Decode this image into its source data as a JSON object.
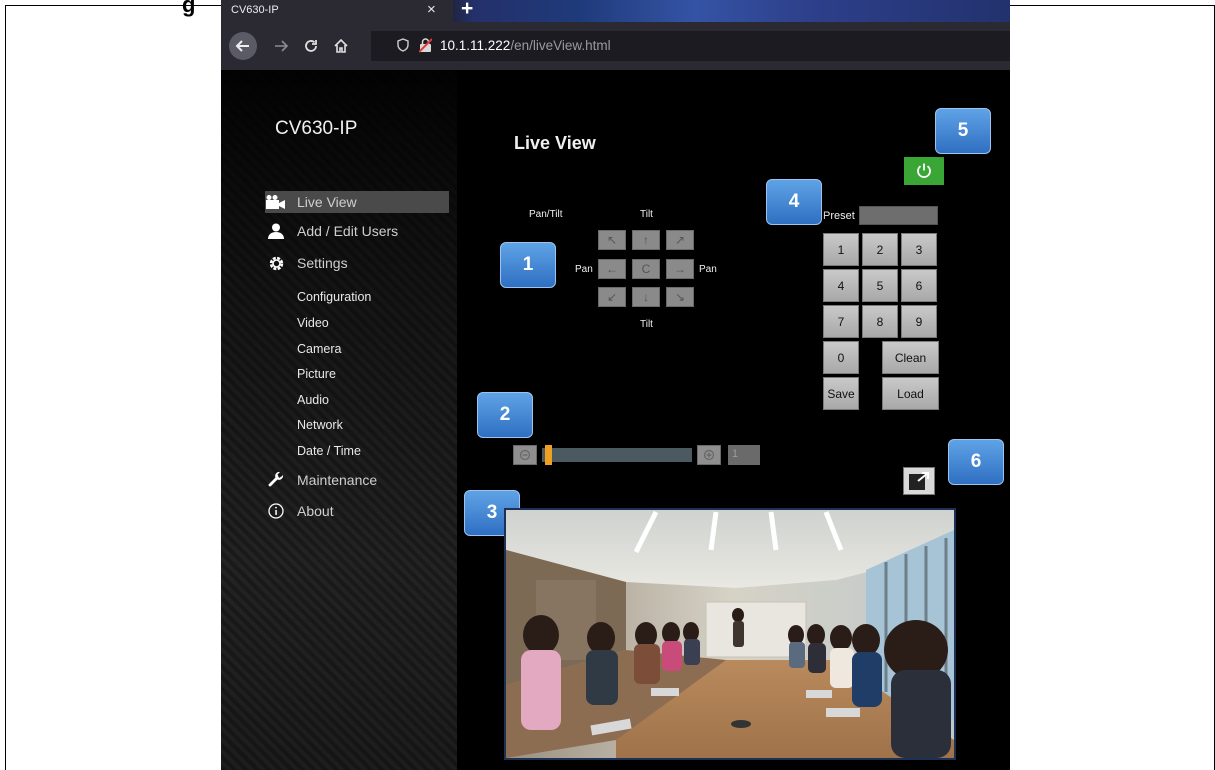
{
  "doc": {
    "heading": "g"
  },
  "browser": {
    "tab_title": "CV630-IP",
    "tab_close": "×",
    "new_tab": "+",
    "url_host": "10.1.11.222",
    "url_path": "/en/liveView.html"
  },
  "app": {
    "title": "CV630-IP"
  },
  "sidebar": {
    "items": [
      {
        "label": "Live View",
        "icon": "video-camera-icon",
        "active": true
      },
      {
        "label": "Add / Edit Users",
        "icon": "user-icon"
      },
      {
        "label": "Settings",
        "icon": "gear-icon"
      },
      {
        "label": "Maintenance",
        "icon": "wrench-icon"
      },
      {
        "label": "About",
        "icon": "info-icon"
      }
    ],
    "settings_sub": [
      "Configuration",
      "Video",
      "Camera",
      "Picture",
      "Audio",
      "Network",
      "Date / Time"
    ]
  },
  "main": {
    "page_title": "Live View",
    "ptz": {
      "pan_tilt_label": "Pan/Tilt",
      "tilt_top": "Tilt",
      "tilt_bottom": "Tilt",
      "pan_left": "Pan",
      "pan_right": "Pan",
      "buttons": [
        "↖",
        "↑",
        "↗",
        "←",
        "C",
        "→",
        "↙",
        "↓",
        "↘"
      ]
    },
    "zoom": {
      "out_icon": "zoom-out-icon",
      "in_icon": "zoom-in-icon",
      "value": "1",
      "level": 0.0
    },
    "preset": {
      "label": "Preset",
      "keys": [
        "1",
        "2",
        "3",
        "4",
        "5",
        "6",
        "7",
        "8",
        "9"
      ],
      "zero": "0",
      "clean": "Clean",
      "save": "Save",
      "load": "Load"
    }
  },
  "callouts": [
    "1",
    "2",
    "3",
    "4",
    "5",
    "6"
  ],
  "colors": {
    "power": "#3aa636",
    "callout": "#4a8ad6",
    "zoom_thumb": "#f0a020"
  }
}
